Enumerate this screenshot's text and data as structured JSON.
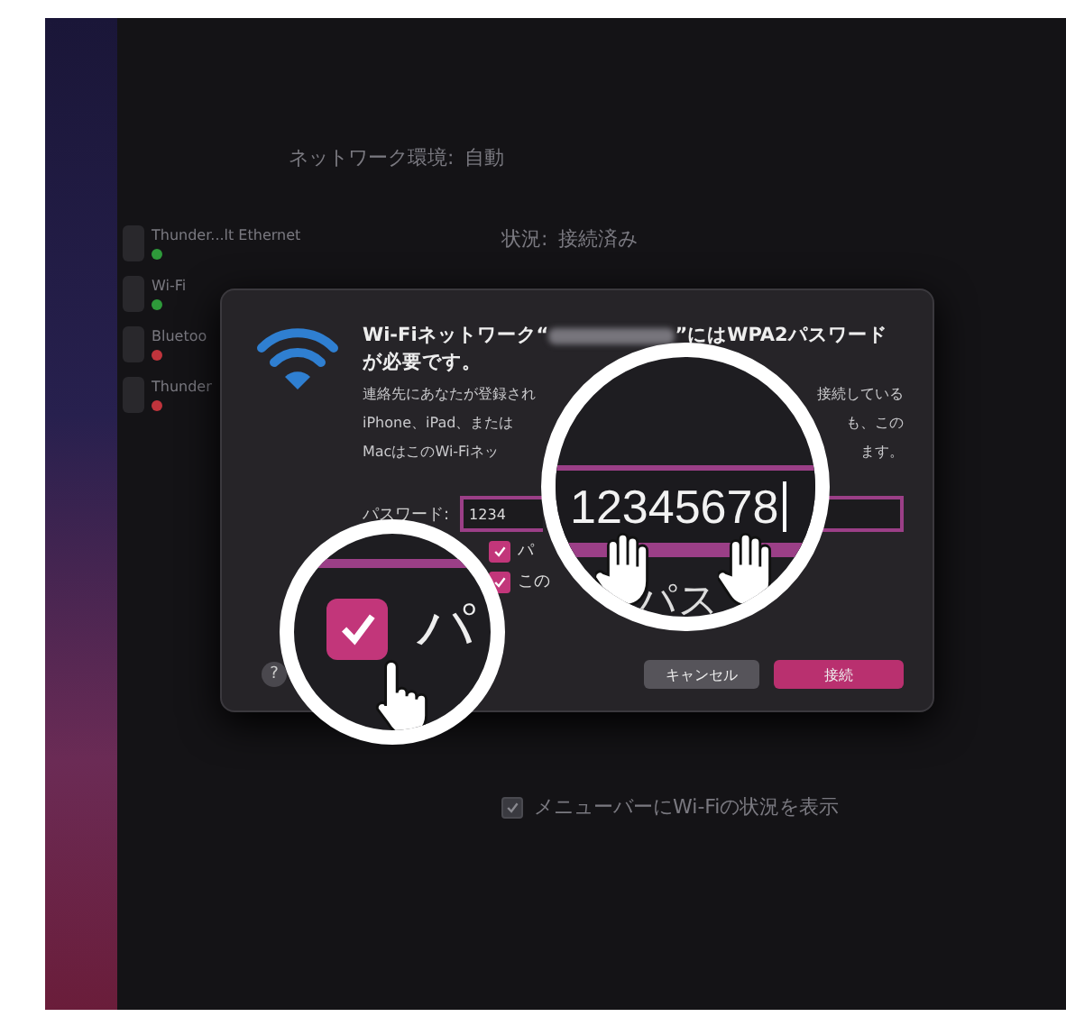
{
  "background_window": {
    "location_label": "ネットワーク環境:",
    "location_value": "自動",
    "status_label": "状況:",
    "status_value": "接続済み",
    "services": [
      {
        "name": "Thunder...lt Ethernet",
        "color": "#2e9a3a"
      },
      {
        "name": "Wi-Fi",
        "color": "#2e9a3a"
      },
      {
        "name": "Bluetoo",
        "color": "#c0343c"
      },
      {
        "name": "Thunder",
        "color": "#c0343c"
      }
    ],
    "menu_bar_option": {
      "label": "メニューバーにWi-Fiの状況を表示",
      "checked": true
    }
  },
  "dialog": {
    "title_prefix": "Wi-Fiネットワーク“",
    "title_suffix": "”にはWPA2パスワードが必要です。",
    "description_lines": [
      {
        "left": "連絡先にあなたが登録され",
        "right": "接続している"
      },
      {
        "left": "iPhone、iPad、または",
        "right": "も、この"
      },
      {
        "left": "MacはこのWi-Fiネッ",
        "right": "ます。"
      }
    ],
    "password_label": "パスワード:",
    "password_value": "1234",
    "checkboxes": [
      {
        "label": "パ",
        "checked": true
      },
      {
        "label": "この",
        "checked": true
      }
    ],
    "buttons": [
      {
        "label": "キャンセル",
        "kind": "secondary"
      },
      {
        "label": "接続",
        "kind": "primary"
      }
    ],
    "help": "?"
  },
  "magnifier_field": {
    "value": "12345678",
    "caption": "パス"
  },
  "magnifier_checkbox": {
    "label": "パ",
    "checked": true
  }
}
